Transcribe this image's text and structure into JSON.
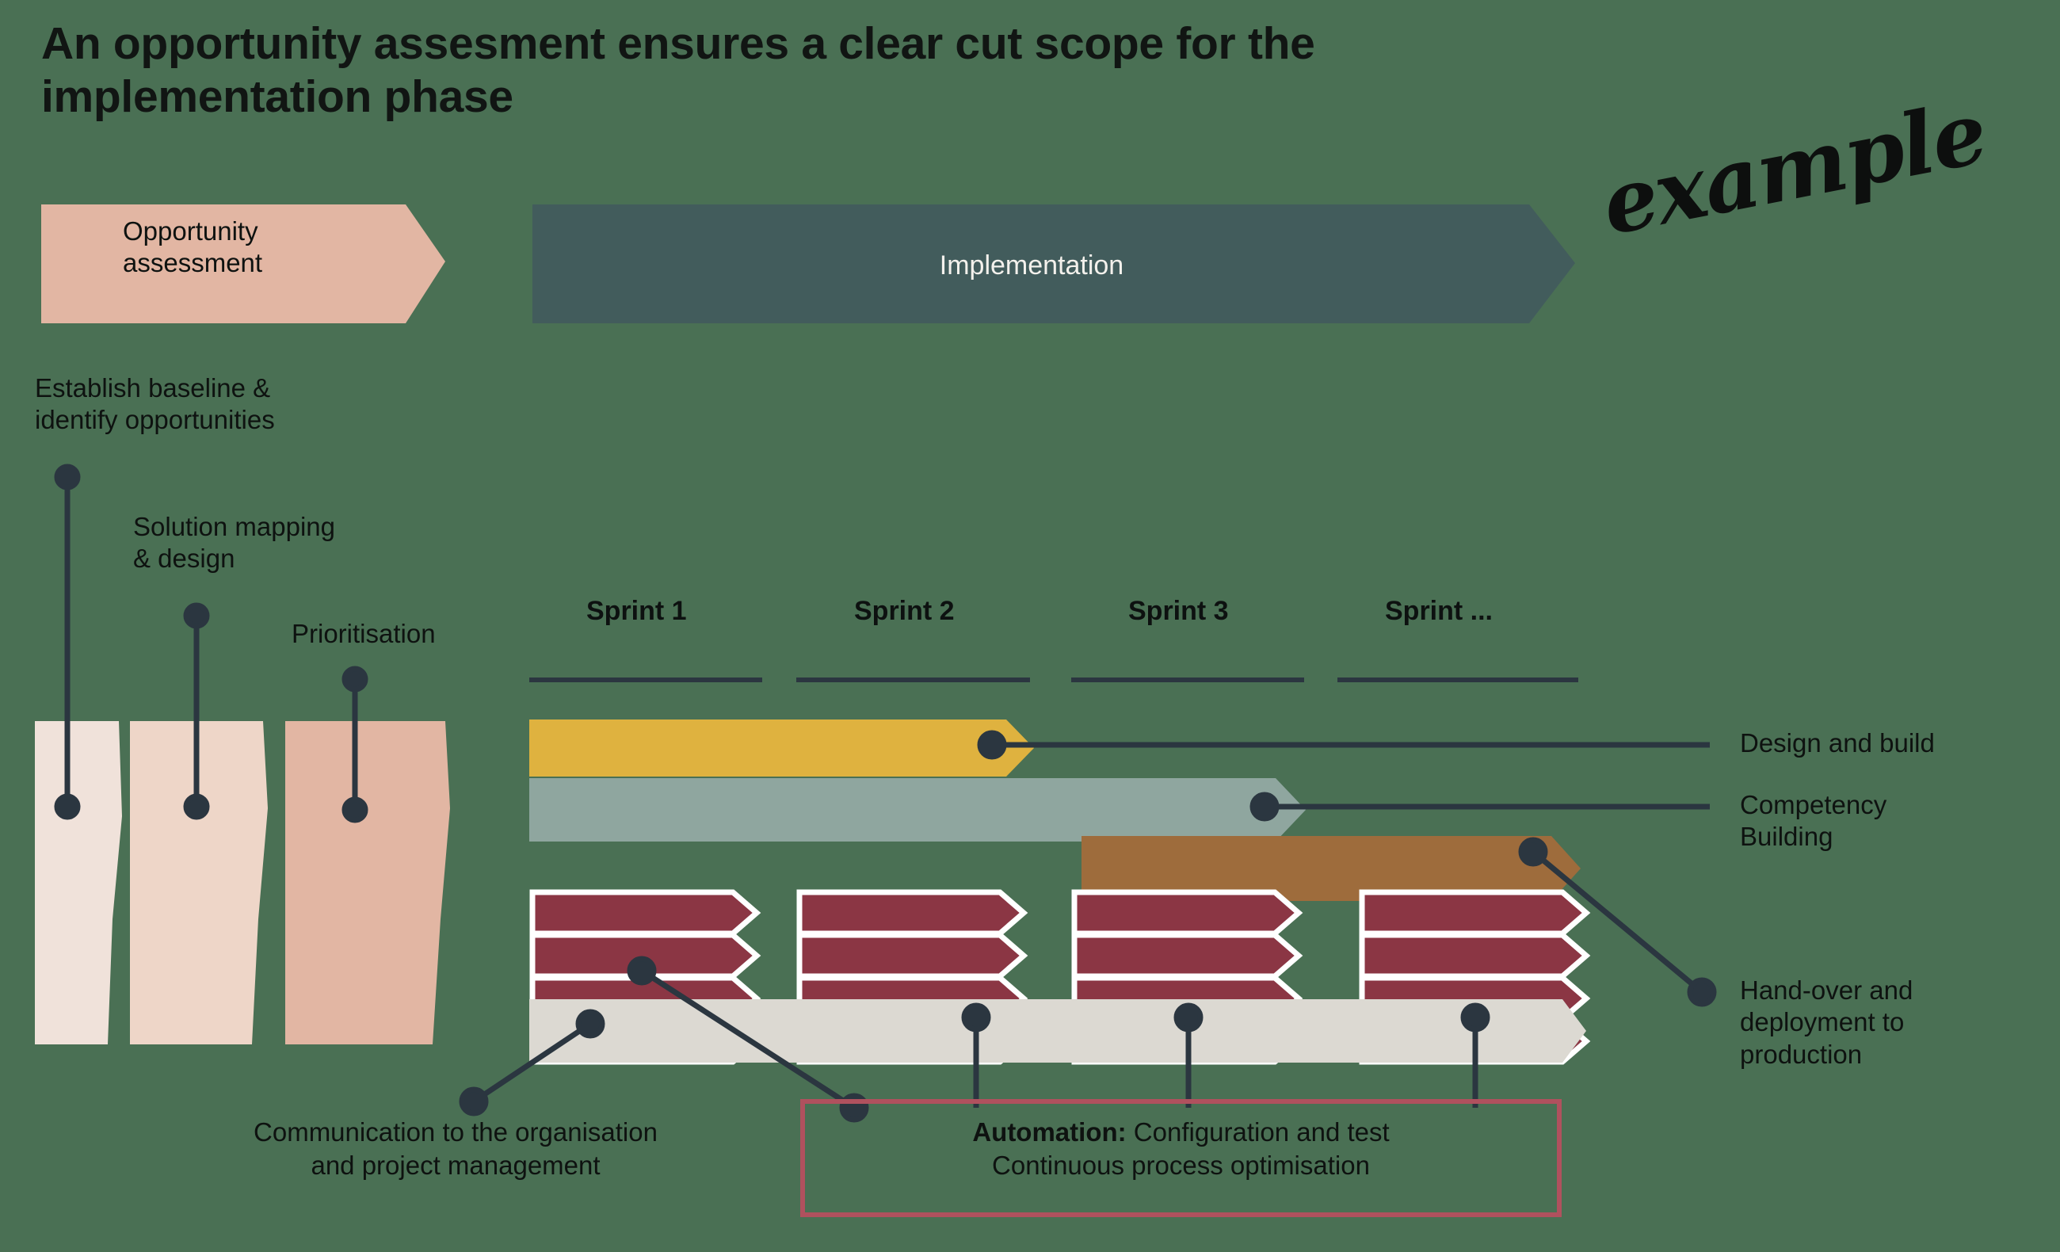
{
  "title": "An opportunity assesment ensures a clear cut scope for the implementation phase",
  "watermark": "example",
  "colors": {
    "background": "#4a7054",
    "opportunity_band": "#e2b6a3",
    "implementation_band": "#425c5c",
    "phase1": "#f0e2da",
    "phase2": "#eed6c8",
    "phase3": "#e2b6a3",
    "design_build": "#dfb23f",
    "competency_building": "#8fa69f",
    "handover": "#9e6c3c",
    "sprint_block": "#8b3644",
    "communication_bar": "#dcd9d2",
    "leader": "#2b3640",
    "automation_box": "#b0515e"
  },
  "phases": {
    "opportunity": {
      "label": "Opportunity\nassessment",
      "label_line1": "Opportunity",
      "label_line2": "assessment"
    },
    "implementation": {
      "label": "Implementation"
    }
  },
  "assessment_steps": [
    {
      "label_line1": "Establish baseline &",
      "label_line2": "identify opportunities"
    },
    {
      "label_line1": "Solution mapping",
      "label_line2": "& design"
    },
    {
      "label_line1": "Prioritisation",
      "label_line2": ""
    }
  ],
  "sprints": [
    {
      "label": "Sprint 1"
    },
    {
      "label": "Sprint 2"
    },
    {
      "label": "Sprint 3"
    },
    {
      "label": "Sprint  ..."
    }
  ],
  "workstreams": [
    {
      "name": "design-and-build",
      "label_line1": "Design and build",
      "label_line2": ""
    },
    {
      "name": "competency-building",
      "label_line1": "Competency",
      "label_line2": "Building"
    },
    {
      "name": "hand-over",
      "label_line1": "Hand-over and",
      "label_line2": "deployment to",
      "label_line3": "production"
    }
  ],
  "captions": {
    "communication": {
      "line1": "Communication to the organisation",
      "line2": "and project management"
    },
    "automation": {
      "bold": "Automation:",
      "rest": " Configuration and test",
      "line2": "Continuous process optimisation"
    }
  },
  "chart_data": {
    "type": "bar",
    "title": "An opportunity assesment ensures a clear cut scope for the implementation phase",
    "xlabel": "",
    "ylabel": "",
    "categories": [
      "Sprint 1",
      "Sprint 2",
      "Sprint 3",
      "Sprint  ..."
    ],
    "phase_bands": [
      {
        "name": "Opportunity assessment",
        "x_start": 52,
        "x_end": 560,
        "color": "#e2b6a3"
      },
      {
        "name": "Implementation",
        "x_start": 672,
        "x_end": 1988,
        "color": "#425c5c"
      }
    ],
    "series": [
      {
        "name": "Design and build",
        "color": "#dfb23f",
        "start_sprint": 1,
        "span_sprints": 2.0,
        "x_start": 668,
        "x_end": 1305
      },
      {
        "name": "Competency Building",
        "color": "#8fa69f",
        "start_sprint": 1,
        "span_sprints": 2.6,
        "x_start": 668,
        "x_end": 1648
      },
      {
        "name": "Hand-over and deployment to production",
        "color": "#9e6c3c",
        "start_sprint": 3,
        "span_sprints": 1.3,
        "x_start": 1365,
        "x_end": 1995
      },
      {
        "name": "Automation / sprint blocks",
        "color": "#8b3644",
        "bars_per_sprint": 4,
        "sprints": 4
      },
      {
        "name": "Communication to the organisation and project management",
        "color": "#dcd9d2",
        "x_start": 668,
        "x_end": 2000
      }
    ],
    "grid": false,
    "legend": "right"
  }
}
